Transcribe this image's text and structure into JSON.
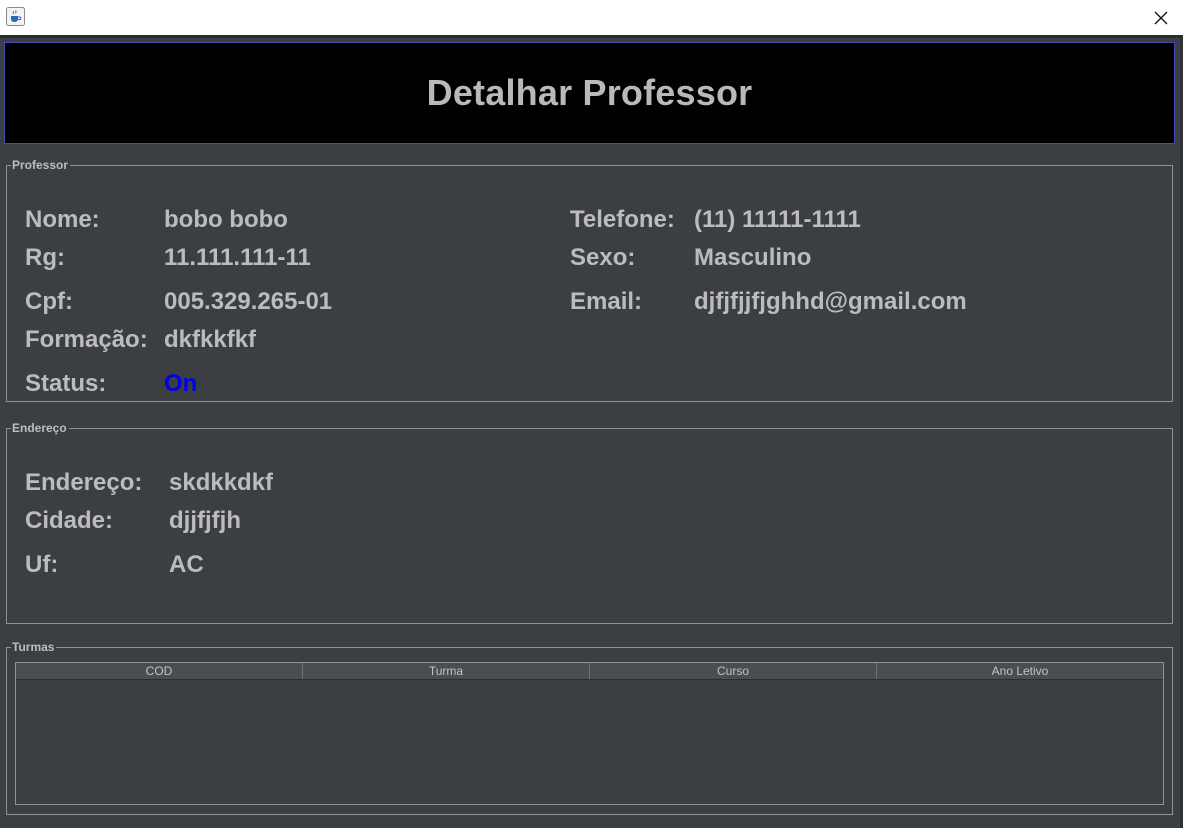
{
  "window": {
    "icon": "java-cup-icon",
    "close_icon": "close-icon"
  },
  "header": {
    "title": "Detalhar Professor"
  },
  "professor": {
    "legend": "Professor",
    "nome_label": "Nome:",
    "nome_value": "bobo bobo",
    "rg_label": "Rg:",
    "rg_value": "11.111.111-11",
    "cpf_label": "Cpf:",
    "cpf_value": "005.329.265-01",
    "formacao_label": "Formação:",
    "formacao_value": "dkfkkfkf",
    "status_label": "Status:",
    "status_value": "On",
    "telefone_label": "Telefone:",
    "telefone_value": "(11) 11111-1111",
    "sexo_label": "Sexo:",
    "sexo_value": "Masculino",
    "email_label": "Email:",
    "email_value": "djfjfjjfjghhd@gmail.com"
  },
  "endereco": {
    "legend": "Endereço",
    "endereco_label": "Endereço:",
    "endereco_value": "skdkkdkf",
    "cidade_label": "Cidade:",
    "cidade_value": "djjfjfjh",
    "uf_label": "Uf:",
    "uf_value": "AC"
  },
  "turmas": {
    "legend": "Turmas",
    "columns": [
      "COD",
      "Turma",
      "Curso",
      "Ano Letivo"
    ],
    "rows": []
  },
  "colors": {
    "header_bg": "#000000",
    "panel_bg": "#3b3e42",
    "text": "#bcbcbc",
    "status_on": "#0000ee"
  }
}
